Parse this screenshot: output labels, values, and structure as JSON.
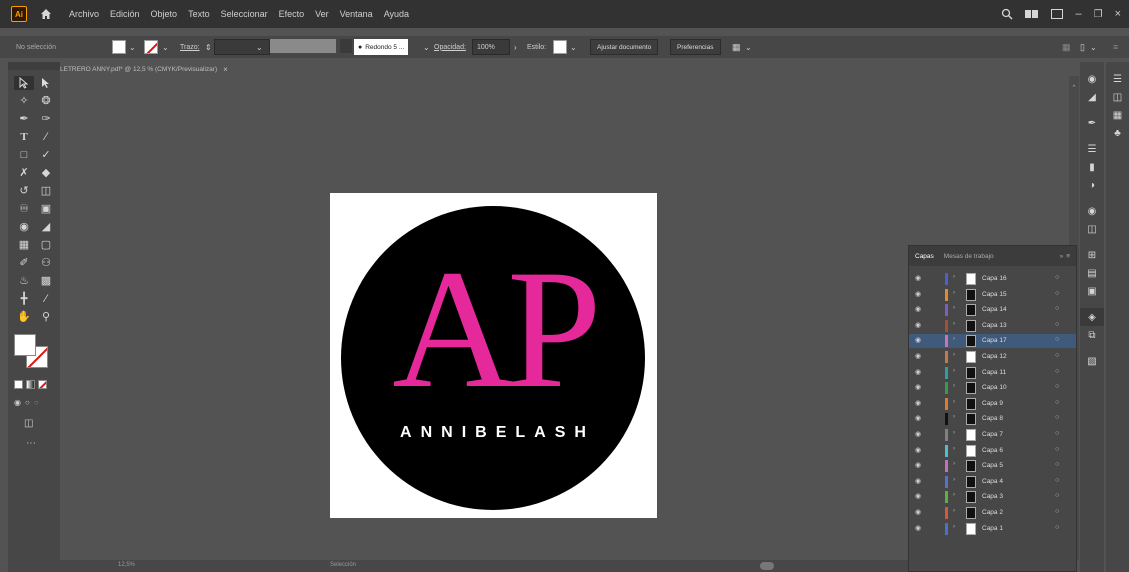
{
  "menubar": {
    "app_logo": "Ai",
    "home_icon": "home-icon",
    "menus": [
      "Archivo",
      "Edición",
      "Objeto",
      "Texto",
      "Seleccionar",
      "Efecto",
      "Ver",
      "Ventana",
      "Ayuda"
    ]
  },
  "control_bar": {
    "selection_status": "No selección",
    "stroke_label": "Trazo:",
    "brush_label": "Redondo 5 ...",
    "opacity_label": "Opacidad:",
    "opacity_value": "100%",
    "style_label": "Estilo:",
    "adjust_doc_button": "Ajustar documento",
    "preferences_button": "Preferencias"
  },
  "document_tab": {
    "title": "LETRERO ANNY.pdf* @ 12,5 % (CMYK/Previsualizar)",
    "close": "×"
  },
  "artwork": {
    "monogram": "AP",
    "brand": "ANNIBELASH",
    "accent_color": "#e5299a"
  },
  "status_bar": {
    "zoom": "12,5%",
    "tool": "Selección"
  },
  "layers_panel": {
    "tab_layers": "Capas",
    "tab_artboards": "Mesas de trabajo",
    "collapse": "»",
    "layers": [
      {
        "name": "Capa 16",
        "color": "#4a5fd0",
        "thumb": "white",
        "selected": false
      },
      {
        "name": "Capa 15",
        "color": "#e08a2a",
        "thumb": "dark",
        "selected": false
      },
      {
        "name": "Capa 14",
        "color": "#7a5fc0",
        "thumb": "dark",
        "selected": false
      },
      {
        "name": "Capa 13",
        "color": "#a0503a",
        "thumb": "dark",
        "selected": false
      },
      {
        "name": "Capa 17",
        "color": "#d070b0",
        "thumb": "dark",
        "selected": true
      },
      {
        "name": "Capa 12",
        "color": "#c07a50",
        "thumb": "white",
        "selected": false
      },
      {
        "name": "Capa 11",
        "color": "#2aa0a0",
        "thumb": "dark",
        "selected": false
      },
      {
        "name": "Capa 10",
        "color": "#3a9a4a",
        "thumb": "dark",
        "selected": false
      },
      {
        "name": "Capa 9",
        "color": "#e07a2a",
        "thumb": "dark",
        "selected": false
      },
      {
        "name": "Capa 8",
        "color": "#111111",
        "thumb": "dark",
        "selected": false
      },
      {
        "name": "Capa 7",
        "color": "#808080",
        "thumb": "white",
        "selected": false
      },
      {
        "name": "Capa 6",
        "color": "#4ac0d0",
        "thumb": "white",
        "selected": false
      },
      {
        "name": "Capa 5",
        "color": "#c070c0",
        "thumb": "dark",
        "selected": false
      },
      {
        "name": "Capa 4",
        "color": "#5a70d0",
        "thumb": "dark",
        "selected": false
      },
      {
        "name": "Capa 3",
        "color": "#5ab040",
        "thumb": "dark",
        "selected": false
      },
      {
        "name": "Capa 2",
        "color": "#d05a3a",
        "thumb": "dark",
        "selected": false
      },
      {
        "name": "Capa 1",
        "color": "#4a6fd0",
        "thumb": "white",
        "selected": false
      }
    ]
  }
}
